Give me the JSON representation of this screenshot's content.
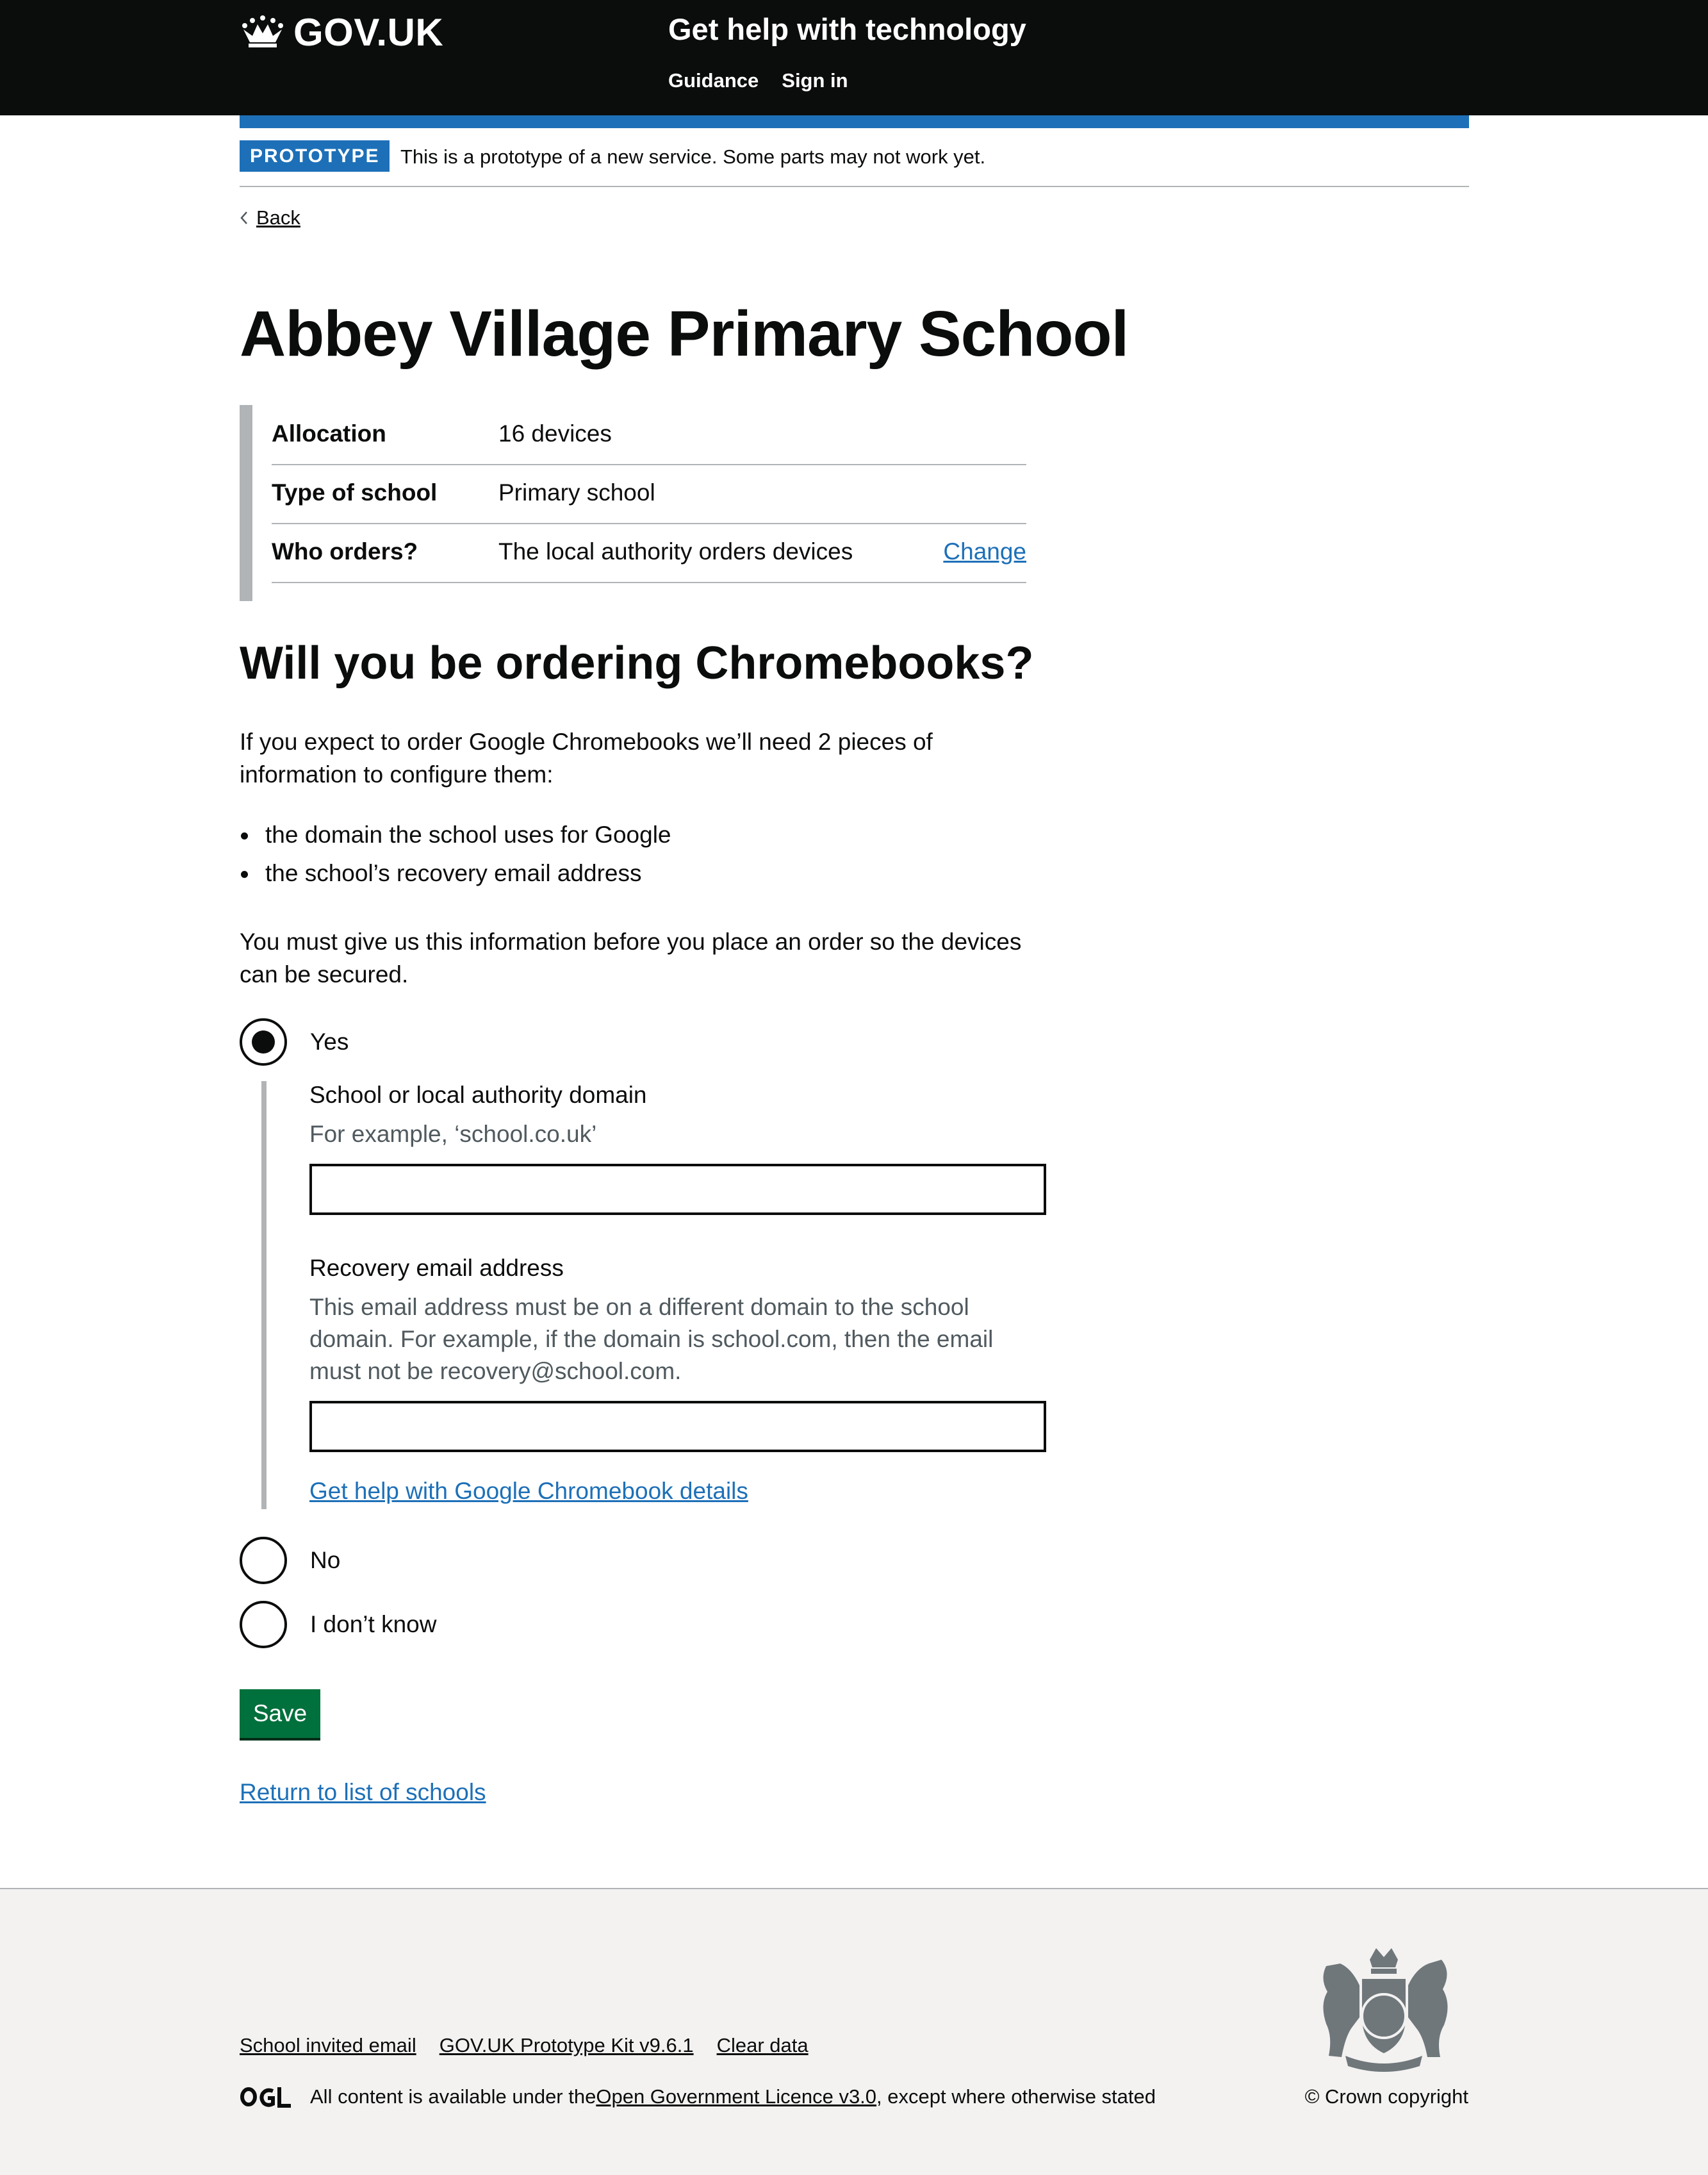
{
  "header": {
    "logo_text": "GOV.UK",
    "service_name": "Get help with technology",
    "nav": [
      "Guidance",
      "Sign in"
    ]
  },
  "phase_banner": {
    "tag": "PROTOTYPE",
    "text": "This is a prototype of a new service. Some parts may not work yet."
  },
  "back_link": "Back",
  "page_title": "Abbey Village Primary School",
  "summary": [
    {
      "key": "Allocation",
      "value": "16 devices",
      "action": ""
    },
    {
      "key": "Type of school",
      "value": "Primary school",
      "action": ""
    },
    {
      "key": "Who orders?",
      "value": "The local authority orders devices",
      "action": "Change"
    }
  ],
  "question": {
    "heading": "Will you be ordering Chromebooks?",
    "intro": "If you expect to order Google Chromebooks we’ll need 2 pieces of information to configure them:",
    "bullets": [
      "the domain the school uses for Google",
      "the school’s recovery email address"
    ],
    "requirement": "You must give us this information before you place an order so the devices can be secured."
  },
  "radios": {
    "yes": {
      "label": "Yes",
      "selected": true
    },
    "no": {
      "label": "No",
      "selected": false
    },
    "dont_know": {
      "label": "I don’t know",
      "selected": false
    }
  },
  "domain_field": {
    "label": "School or local authority domain",
    "hint": "For example, ‘school.co.uk’",
    "value": ""
  },
  "email_field": {
    "label": "Recovery email address",
    "hint": "This email address must be on a different domain to the school domain. For example, if the domain is school.com, then the email must not be recovery@school.com.",
    "value": ""
  },
  "help_link": "Get help with Google Chromebook details",
  "save_button": "Save",
  "return_link": "Return to list of schools",
  "footer": {
    "links": [
      "School invited email",
      "GOV.UK Prototype Kit v9.6.1",
      "Clear data"
    ],
    "licence_prefix": "All content is available under the ",
    "licence_link": "Open Government Licence v3.0",
    "licence_suffix": ", except where otherwise stated",
    "copyright": "© Crown copyright"
  },
  "colors": {
    "header_bg": "#0b0c0c",
    "brand_blue": "#1d70b8",
    "button_green": "#00703c",
    "footer_bg": "#f3f2f1",
    "border_grey": "#b1b4b6",
    "hint_grey": "#505a5f"
  }
}
